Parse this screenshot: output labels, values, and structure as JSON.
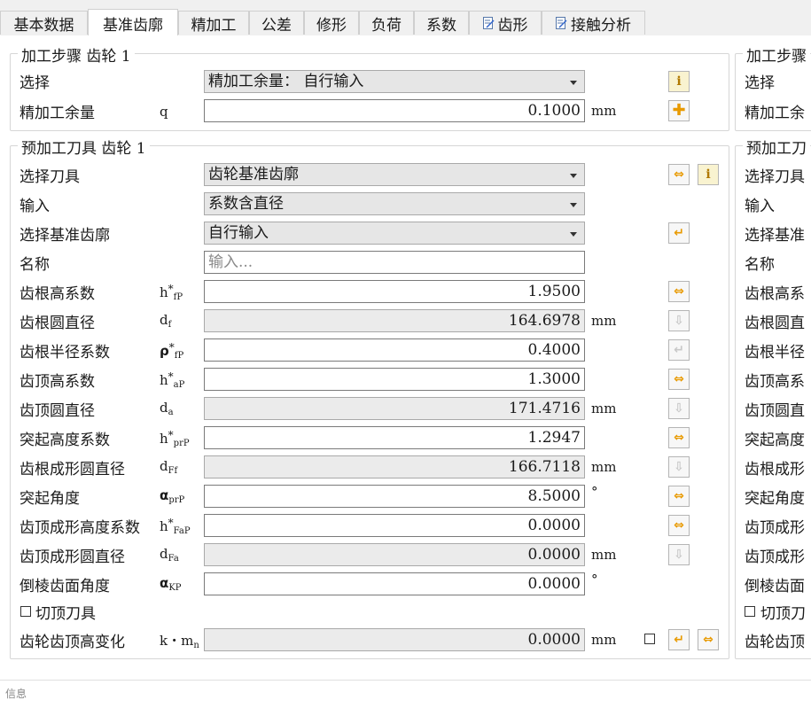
{
  "tabs": [
    {
      "label": "基本数据"
    },
    {
      "label": "基准齿廓"
    },
    {
      "label": "精加工"
    },
    {
      "label": "公差"
    },
    {
      "label": "修形"
    },
    {
      "label": "负荷"
    },
    {
      "label": "系数"
    },
    {
      "label": "齿形",
      "icon": "edit-icon"
    },
    {
      "label": "接触分析",
      "icon": "edit-icon"
    }
  ],
  "active_tab": "基准齿廓",
  "process": {
    "title": "加工步骤 齿轮 1",
    "select_label": "选择",
    "select_value": "精加工余量：  自行输入",
    "allowance_label": "精加工余量",
    "allowance_symbol": "q",
    "allowance_value": "0.1000",
    "unit_mm": "mm"
  },
  "tool": {
    "title": "预加工刀具 齿轮 1",
    "select_tool_label": "选择刀具",
    "select_tool_value": "齿轮基准齿廓",
    "input_label": "输入",
    "input_value": "系数含直径",
    "profile_label": "选择基准齿廓",
    "profile_value": "自行输入",
    "name_label": "名称",
    "name_placeholder": "输入...",
    "rows": [
      {
        "label": "齿根高系数",
        "sym": "h",
        "sup": "*",
        "sub": "fP",
        "value": "1.9500",
        "unit": ""
      },
      {
        "label": "齿根圆直径",
        "sym": "d",
        "sup": "",
        "sub": "f",
        "value": "164.6978",
        "unit": "mm"
      },
      {
        "label": "齿根半径系数",
        "sym": "ρ",
        "sup": "*",
        "sub": "fP",
        "value": "0.4000",
        "unit": ""
      },
      {
        "label": "齿顶高系数",
        "sym": "h",
        "sup": "*",
        "sub": "aP",
        "value": "1.3000",
        "unit": ""
      },
      {
        "label": "齿顶圆直径",
        "sym": "d",
        "sup": "",
        "sub": "a",
        "value": "171.4716",
        "unit": "mm"
      },
      {
        "label": "突起高度系数",
        "sym": "h",
        "sup": "*",
        "sub": "prP",
        "value": "1.2947",
        "unit": ""
      },
      {
        "label": "齿根成形圆直径",
        "sym": "d",
        "sup": "",
        "sub": "Ff",
        "value": "166.7118",
        "unit": "mm"
      },
      {
        "label": "突起角度",
        "sym": "α",
        "sup": "",
        "sub": "prP",
        "value": "8.5000",
        "unit": "°"
      },
      {
        "label": "齿顶成形高度系数",
        "sym": "h",
        "sup": "*",
        "sub": "FaP",
        "value": "0.0000",
        "unit": ""
      },
      {
        "label": "齿顶成形圆直径",
        "sym": "d",
        "sup": "",
        "sub": "Fa",
        "value": "0.0000",
        "unit": "mm"
      },
      {
        "label": "倒棱齿面角度",
        "sym": "α",
        "sup": "",
        "sub": "KP",
        "value": "0.0000",
        "unit": "°"
      }
    ],
    "topping_label": "切顶刀具",
    "tip_change_label": "齿轮齿顶高变化",
    "tip_change_sym": "k・m",
    "tip_change_sub": "n",
    "tip_change_value": "0.0000",
    "tip_change_unit": "mm"
  },
  "right_panel": {
    "process_title": "加工步骤",
    "process_labels": [
      "选择",
      "精加工余"
    ],
    "tool_title": "预加工刀",
    "tool_labels": [
      "选择刀具",
      "输入",
      "选择基准",
      "名称",
      "齿根高系",
      "齿根圆直",
      "齿根半径",
      "齿顶高系",
      "齿顶圆直",
      "突起高度",
      "齿根成形",
      "突起角度",
      "齿顶成形",
      "齿顶成形",
      "倒棱齿面"
    ],
    "topping_label": "切顶刀",
    "tip_change_label": "齿轮齿顶"
  },
  "status": {
    "text": "信息"
  },
  "colors": {
    "accent_orange": "#e89a00",
    "disabled_gray": "#c8c8c8"
  }
}
